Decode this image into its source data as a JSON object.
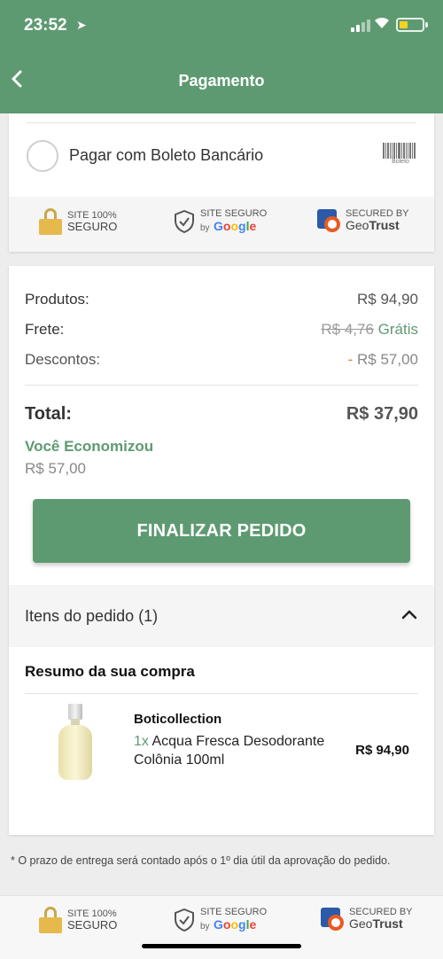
{
  "status": {
    "time": "23:52"
  },
  "header": {
    "title": "Pagamento"
  },
  "payment": {
    "boleto_label": "Pagar com Boleto Bancário",
    "boleto_icon_text": "Boleto"
  },
  "seals": {
    "site100_line1": "SITE 100%",
    "site100_line2": "SEGURO",
    "google_line1": "SITE SEGURO",
    "google_by": "by",
    "geotrust_line1": "SECURED BY",
    "geotrust_geo": "Geo",
    "geotrust_trust": "Trust"
  },
  "summary": {
    "produtos_label": "Produtos:",
    "produtos_value": "R$ 94,90",
    "frete_label": "Frete:",
    "frete_old": "R$ 4,76",
    "frete_value": "Grátis",
    "descontos_label": "Descontos:",
    "descontos_sign": "-",
    "descontos_value": "R$ 57,00",
    "total_label": "Total:",
    "total_value": "R$ 37,90",
    "econ_label": "Você Economizou",
    "econ_value": "R$ 57,00"
  },
  "finalize_label": "FINALIZAR PEDIDO",
  "items": {
    "header": "Itens do pedido (1)",
    "summary_title": "Resumo da sua compra",
    "products": [
      {
        "brand": "Boticollection",
        "qty": "1x",
        "name": "Acqua Fresca Desodorante Colônia 100ml",
        "price": "R$ 94,90"
      }
    ]
  },
  "footnote": "* O prazo de entrega será contado após o 1º dia útil da aprovação do pedido.",
  "colors": {
    "brand_green": "#5e9a71",
    "discount_orange": "#e07b39"
  },
  "icons": [
    "location-arrow-icon",
    "signal-icon",
    "wifi-icon",
    "battery-icon",
    "back-icon",
    "barcode-icon",
    "lock-icon",
    "shield-icon",
    "geotrust-icon",
    "chevron-up-icon"
  ]
}
